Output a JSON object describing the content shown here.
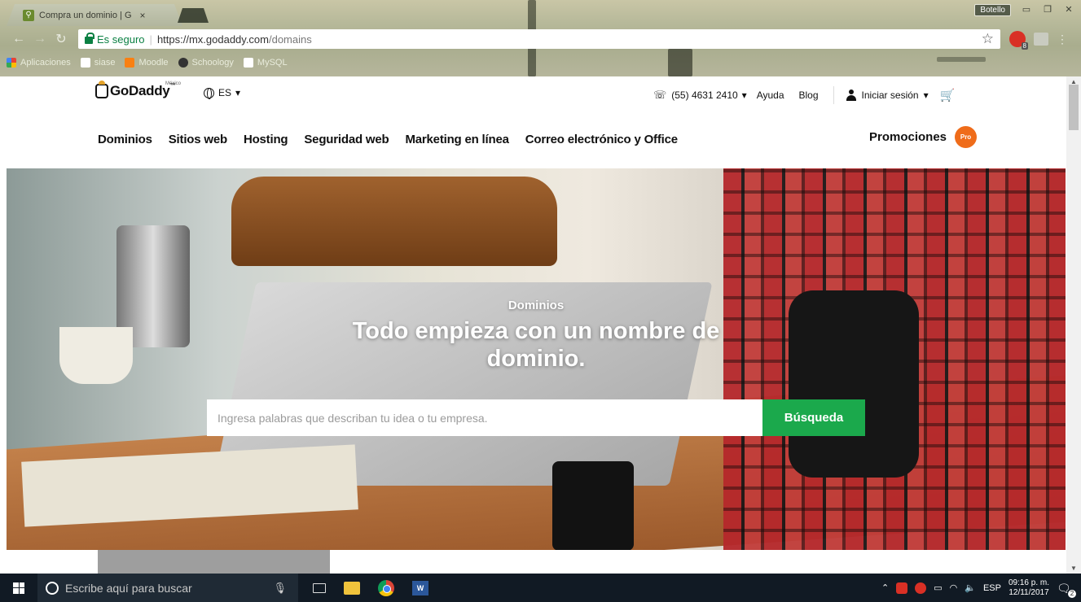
{
  "browser": {
    "tab_title": "Compra un dominio | G",
    "tab_close": "×",
    "profile_name": "Botello",
    "secure_label": "Es seguro",
    "url_host": "https://mx.godaddy.com",
    "url_path": "/domains",
    "bookmarks": [
      "Aplicaciones",
      "siase",
      "Moodle",
      "Schoology",
      "MySQL"
    ]
  },
  "header": {
    "logo_text": "GoDaddy",
    "logo_tm": "™",
    "logo_country": "México",
    "lang": "ES",
    "phone": "(55) 4631 2410",
    "help": "Ayuda",
    "blog": "Blog",
    "signin": "Iniciar sesión"
  },
  "nav": {
    "items": [
      "Dominios",
      "Sitios web",
      "Hosting",
      "Seguridad web",
      "Marketing en línea",
      "Correo electrónico y Office"
    ],
    "promo": "Promociones",
    "pro_badge": "Pro"
  },
  "hero": {
    "eyebrow": "Dominios",
    "title_line1": "Todo empieza con un nombre de",
    "title_line2": "dominio.",
    "search_placeholder": "Ingresa palabras que describan tu idea o tu empresa.",
    "search_button": "Búsqueda"
  },
  "taskbar": {
    "search_placeholder": "Escribe aquí para buscar",
    "lang": "ESP",
    "time": "09:16 p. m.",
    "date": "12/11/2017",
    "notifications": "2"
  }
}
